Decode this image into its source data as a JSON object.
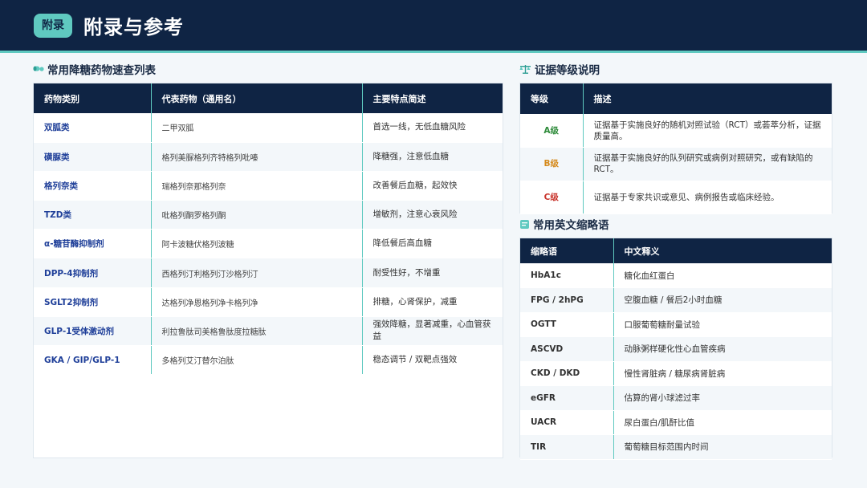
{
  "header": {
    "badge": "附录",
    "title": "附录与参考"
  },
  "drug_section": {
    "title": "常用降糖药物速查列表",
    "columns": [
      "药物类别",
      "代表药物（通用名）",
      "主要特点简述"
    ],
    "rows": [
      [
        "双胍类",
        "二甲双胍",
        "首选一线，无低血糖风险"
      ],
      [
        "磺脲类",
        "格列美脲格列齐特格列吡嗪",
        "降糖强，注意低血糖"
      ],
      [
        "格列奈类",
        "瑞格列奈那格列奈",
        "改善餐后血糖，起效快"
      ],
      [
        "TZD类",
        "吡格列酮罗格列酮",
        "增敏剂，注意心衰风险"
      ],
      [
        "α-糖苷酶抑制剂",
        "阿卡波糖伏格列波糖",
        "降低餐后高血糖"
      ],
      [
        "DPP-4抑制剂",
        "西格列汀利格列汀沙格列汀",
        "耐受性好，不增重"
      ],
      [
        "SGLT2抑制剂",
        "达格列净恩格列净卡格列净",
        "排糖，心肾保护，减重"
      ],
      [
        "GLP-1受体激动剂",
        "利拉鲁肽司美格鲁肽度拉糖肽",
        "强效降糖，显著减重，心血管获益"
      ],
      [
        "GKA / GIP/GLP-1",
        "多格列艾汀替尔泊肽",
        "稳态调节 / 双靶点强效"
      ]
    ]
  },
  "evidence_section": {
    "title": "证据等级说明",
    "columns": [
      "等级",
      "描述"
    ],
    "rows": [
      {
        "grade": "A级",
        "color": "#2e8b3a",
        "desc": "证据基于实施良好的随机对照试验（RCT）或荟萃分析，证据质量高。"
      },
      {
        "grade": "B级",
        "color": "#d58a1c",
        "desc": "证据基于实施良好的队列研究或病例对照研究，或有缺陷的RCT。"
      },
      {
        "grade": "C级",
        "color": "#c8322a",
        "desc": "证据基于专家共识或意见、病例报告或临床经验。"
      }
    ]
  },
  "abbr_section": {
    "title": "常用英文缩略语",
    "columns": [
      "缩略语",
      "中文释义"
    ],
    "rows": [
      [
        "HbA1c",
        "糖化血红蛋白"
      ],
      [
        "FPG / 2hPG",
        "空腹血糖 / 餐后2小时血糖"
      ],
      [
        "OGTT",
        "口服葡萄糖耐量试验"
      ],
      [
        "ASCVD",
        "动脉粥样硬化性心血管疾病"
      ],
      [
        "CKD / DKD",
        "慢性肾脏病 / 糖尿病肾脏病"
      ],
      [
        "eGFR",
        "估算的肾小球滤过率"
      ],
      [
        "UACR",
        "尿白蛋白/肌酐比值"
      ],
      [
        "TIR",
        "葡萄糖目标范围内时间"
      ]
    ]
  },
  "colors": {
    "navy": "#0f2444",
    "teal": "#5fc9c0",
    "category_blue": "#1f3f99"
  }
}
